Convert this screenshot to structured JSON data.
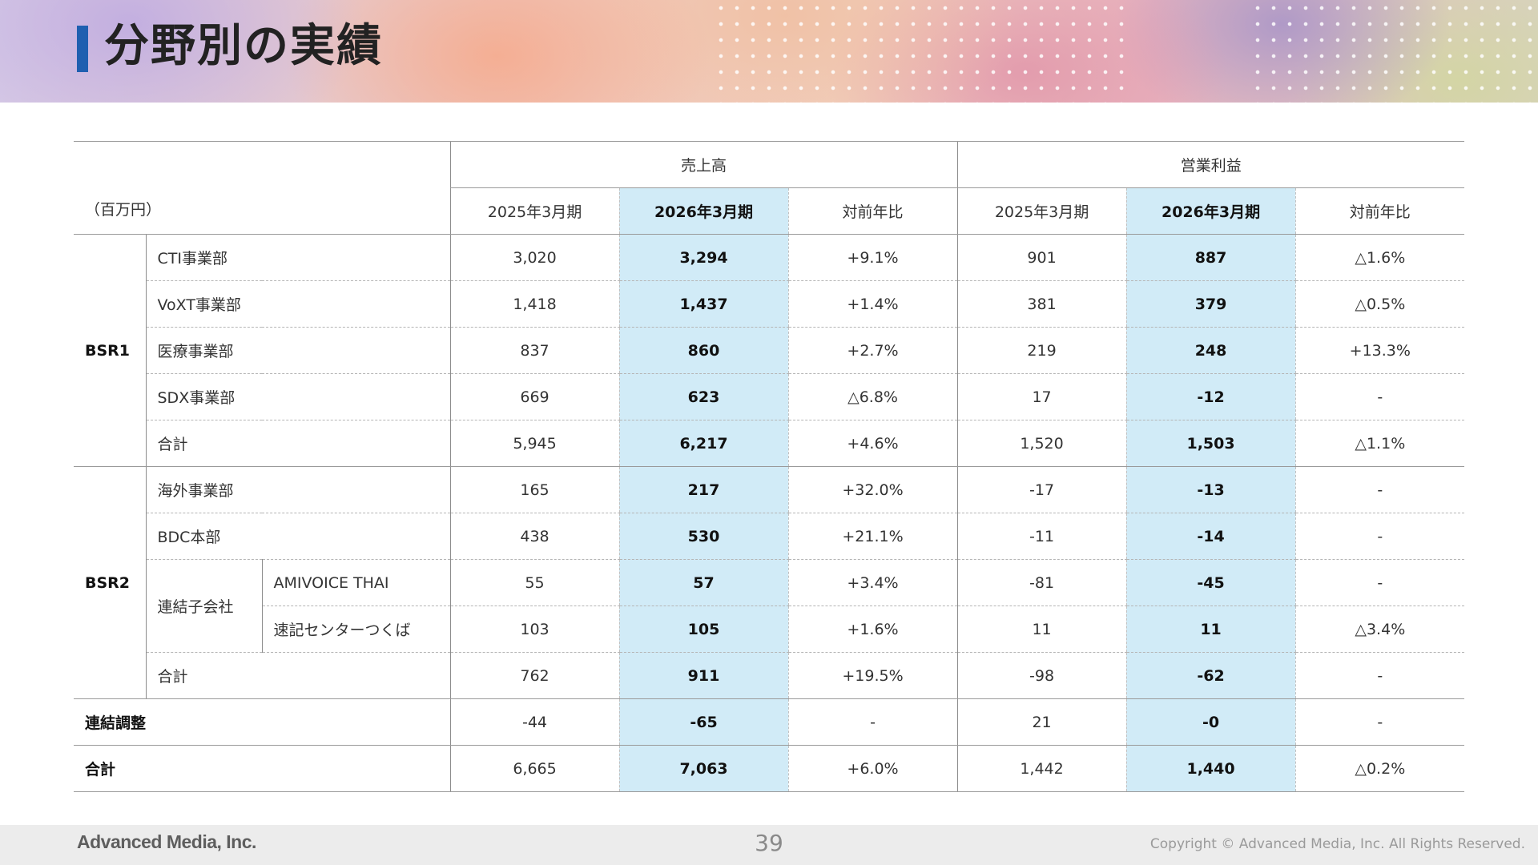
{
  "title": "分野別の実績",
  "table": {
    "unit_label": "（百万円）",
    "group_headers": [
      "売上高",
      "営業利益"
    ],
    "sub_headers": [
      "2025年3月期",
      "2026年3月期",
      "対前年比",
      "2025年3月期",
      "2026年3月期",
      "対前年比"
    ],
    "bsr1": {
      "label": "BSR1",
      "rows": [
        {
          "name": "CTI事業部",
          "values": [
            "3,020",
            "3,294",
            "+9.1%",
            "901",
            "887",
            "△1.6%"
          ]
        },
        {
          "name": "VoXT事業部",
          "values": [
            "1,418",
            "1,437",
            "+1.4%",
            "381",
            "379",
            "△0.5%"
          ]
        },
        {
          "name": "医療事業部",
          "values": [
            "837",
            "860",
            "+2.7%",
            "219",
            "248",
            "+13.3%"
          ]
        },
        {
          "name": "SDX事業部",
          "values": [
            "669",
            "623",
            "△6.8%",
            "17",
            "-12",
            "-"
          ]
        },
        {
          "name": "合計",
          "values": [
            "5,945",
            "6,217",
            "+4.6%",
            "1,520",
            "1,503",
            "△1.1%"
          ]
        }
      ]
    },
    "bsr2": {
      "label": "BSR2",
      "subsidiary_label": "連結子会社",
      "rows": [
        {
          "name": "海外事業部",
          "values": [
            "165",
            "217",
            "+32.0%",
            "-17",
            "-13",
            "-"
          ]
        },
        {
          "name": "BDC本部",
          "values": [
            "438",
            "530",
            "+21.1%",
            "-11",
            "-14",
            "-"
          ]
        },
        {
          "name": "AMIVOICE THAI",
          "values": [
            "55",
            "57",
            "+3.4%",
            "-81",
            "-45",
            "-"
          ]
        },
        {
          "name": "速記センターつくば",
          "values": [
            "103",
            "105",
            "+1.6%",
            "11",
            "11",
            "△3.4%"
          ]
        },
        {
          "name": "合計",
          "values": [
            "762",
            "911",
            "+19.5%",
            "-98",
            "-62",
            "-"
          ]
        }
      ]
    },
    "adjustment": {
      "name": "連結調整",
      "values": [
        "-44",
        "-65",
        "-",
        "21",
        "-0",
        "-"
      ]
    },
    "total": {
      "name": "合計",
      "values": [
        "6,665",
        "7,063",
        "+6.0%",
        "1,442",
        "1,440",
        "△0.2%"
      ]
    }
  },
  "footer": {
    "logo": "Advanced Media, Inc.",
    "page_number": "39",
    "copyright": "Copyright © Advanced Media, Inc. All Rights Reserved."
  }
}
